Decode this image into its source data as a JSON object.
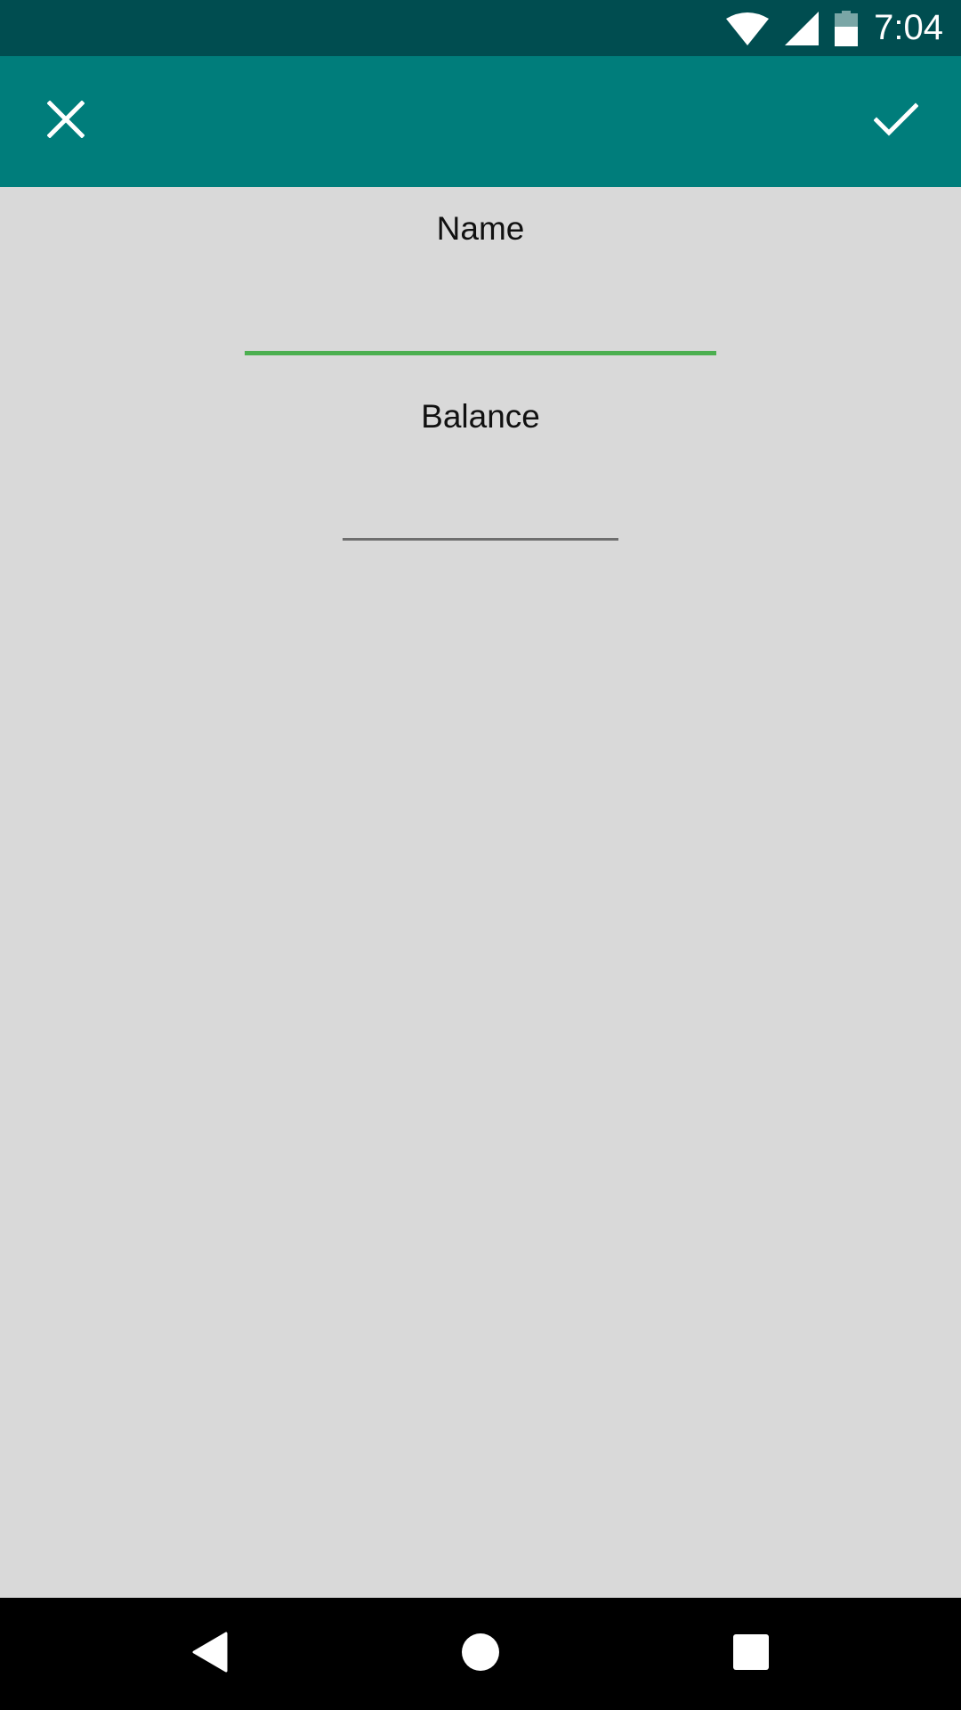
{
  "status_bar": {
    "time": "7:04",
    "icons": [
      "wifi-icon",
      "cell-signal-icon",
      "battery-icon"
    ]
  },
  "app_bar": {
    "close_icon": "close-icon",
    "save_icon": "check-icon",
    "background": "#007d7b"
  },
  "form": {
    "name_label": "Name",
    "name_value": "",
    "balance_label": "Balance",
    "balance_value": ""
  },
  "nav_bar": {
    "icons": [
      "back-icon",
      "home-icon",
      "recents-icon"
    ]
  },
  "colors": {
    "status_bar": "#004d50",
    "app_bar": "#007d7b",
    "background": "#d9d9d9",
    "focused_underline": "#4caf50",
    "underline": "#6e6e6e"
  }
}
